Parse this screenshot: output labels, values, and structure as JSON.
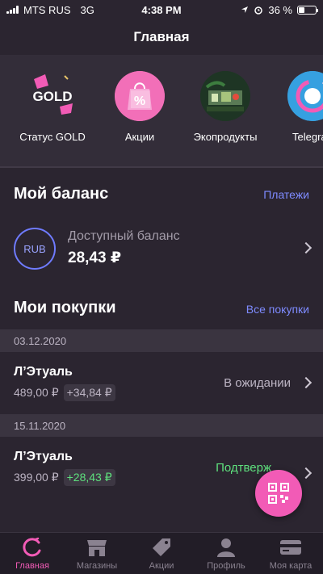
{
  "status_bar": {
    "carrier": "MTS RUS",
    "network": "3G",
    "time": "4:38 PM",
    "battery": "36 %",
    "battery_level_percent": 36
  },
  "header": {
    "title": "Главная"
  },
  "stories": [
    {
      "label": "Статус GOLD",
      "badge": "GOLD",
      "icon": "gold-status-icon"
    },
    {
      "label": "Акции",
      "badge": "%",
      "icon": "shopping-bag-percent-icon"
    },
    {
      "label": "Экопродукты",
      "icon": "eco-products-icon"
    },
    {
      "label": "Telegra",
      "icon": "telegram-icon"
    }
  ],
  "balance": {
    "title": "Мой баланс",
    "link": "Платежи",
    "currency": "RUB",
    "label": "Доступный баланс",
    "value": "28,43 ₽"
  },
  "purchases": {
    "title": "Мои покупки",
    "link": "Все покупки",
    "groups": [
      {
        "date": "03.12.2020",
        "store": "Л’Этуаль",
        "amount": "489,00 ₽",
        "cashback": "+34,84 ₽",
        "status": "В ожидании"
      },
      {
        "date": "15.11.2020",
        "store": "Л’Этуаль",
        "amount": "399,00 ₽",
        "cashback": "+28,43 ₽",
        "status": "Подтверж"
      }
    ]
  },
  "tabbar": {
    "items": [
      {
        "label": "Главная",
        "icon": "home-icon",
        "active": true
      },
      {
        "label": "Магазины",
        "icon": "store-icon",
        "active": false
      },
      {
        "label": "Акции",
        "icon": "tag-icon",
        "active": false
      },
      {
        "label": "Профиль",
        "icon": "profile-icon",
        "active": false
      },
      {
        "label": "Моя карта",
        "icon": "card-icon",
        "active": false
      }
    ]
  },
  "colors": {
    "background": "#2b2530",
    "accent_pink": "#f25bb6",
    "link_blue": "#7e8bff",
    "success_green": "#5ee07d"
  }
}
